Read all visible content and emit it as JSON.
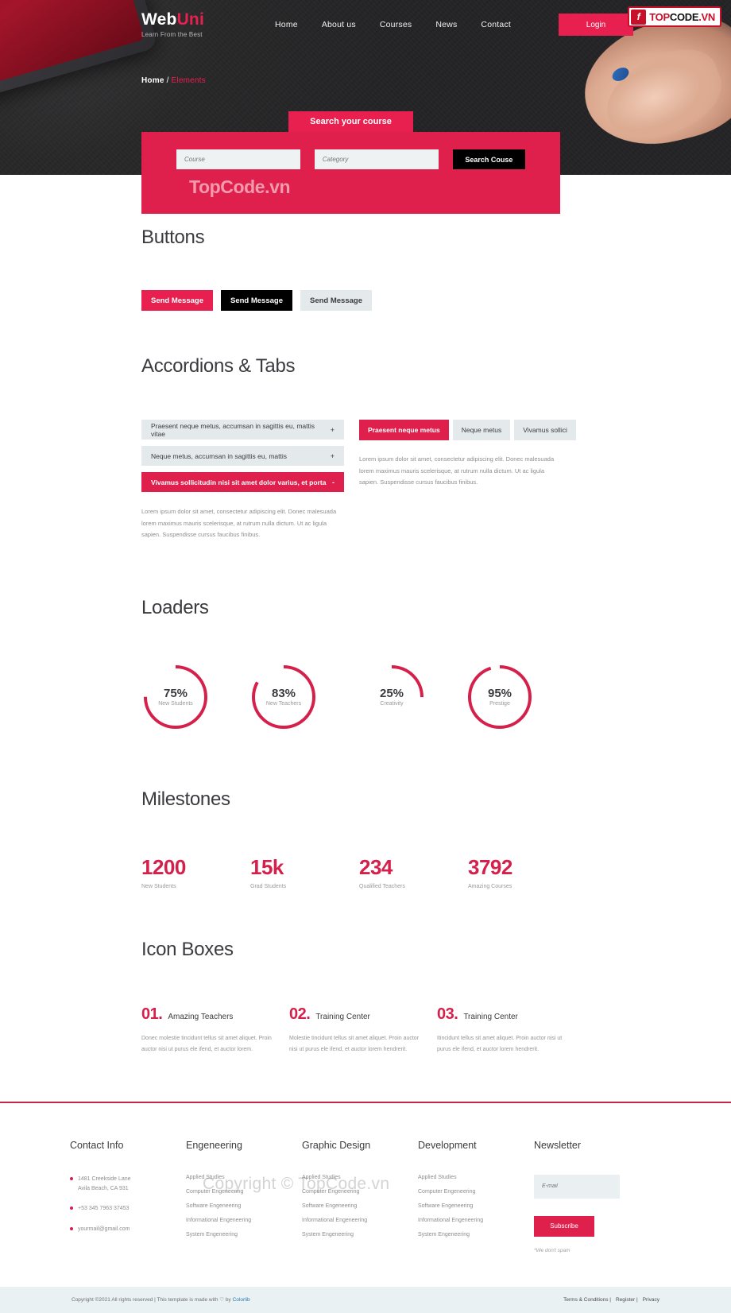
{
  "brand": {
    "accent": "#e0204c",
    "dark": "#232325",
    "light": "#e4eaec"
  },
  "header": {
    "logo_web": "Web",
    "logo_uni": "Uni",
    "tagline": "Learn From the Best",
    "nav": [
      {
        "label": "Home"
      },
      {
        "label": "About us"
      },
      {
        "label": "Courses"
      },
      {
        "label": "News"
      },
      {
        "label": "Contact"
      }
    ],
    "login_label": "Login"
  },
  "badge": {
    "mark": "f",
    "t1": "TOP",
    "t2": "CODE",
    "t3": ".VN"
  },
  "breadcrumb": {
    "home": "Home",
    "sep": "/",
    "current": "Elements"
  },
  "search": {
    "tab_label": "Search your course",
    "course_placeholder": "Course",
    "course_value": "",
    "category_placeholder": "Category",
    "category_value": "",
    "submit_label": "Search Couse",
    "watermark": "TopCode.vn"
  },
  "buttons_section": {
    "title": "Buttons",
    "buttons": [
      {
        "label": "Send Message",
        "style": "primary"
      },
      {
        "label": "Send Message",
        "style": "dark"
      },
      {
        "label": "Send Message",
        "style": "light"
      }
    ]
  },
  "accordions_section": {
    "title": "Accordions & Tabs",
    "accordion": [
      {
        "label": "Praesent neque metus, accumsan in sagittis eu, mattis vitae",
        "sign": "+",
        "active": false
      },
      {
        "label": "Neque metus, accumsan in sagittis eu, mattis",
        "sign": "+",
        "active": false
      },
      {
        "label": "Vivamus sollicitudin nisi sit amet dolor varius, et porta",
        "sign": "-",
        "active": true
      }
    ],
    "accordion_body": "Lorem ipsum dolor sit amet, consectetur adipiscing elit. Donec malesuada lorem maximus mauris scelerisque, at rutrum nulla dictum. Ut ac ligula sapien. Suspendisse cursus faucibus finibus.",
    "tabs": [
      {
        "label": "Praesent neque metus",
        "active": true
      },
      {
        "label": "Neque metus",
        "active": false
      },
      {
        "label": "Vivamus sollici",
        "active": false
      }
    ],
    "tab_body": "Lorem ipsum dolor sit amet, consectetur adipiscing elit. Donec malesuada lorem maximus mauris scelerisque, at rutrum nulla dictum. Ut ac ligula sapien. Suspendisse cursus faucibus finibus."
  },
  "loaders_section": {
    "title": "Loaders",
    "items": [
      {
        "percent": "75%",
        "value": 75,
        "label": "New Students"
      },
      {
        "percent": "83%",
        "value": 83,
        "label": "New Teachers"
      },
      {
        "percent": "25%",
        "value": 25,
        "label": "Creativity"
      },
      {
        "percent": "95%",
        "value": 95,
        "label": "Prestige"
      }
    ]
  },
  "milestones_section": {
    "title": "Milestones",
    "items": [
      {
        "number": "1200",
        "label": "New Students"
      },
      {
        "number": "15k",
        "label": "Grad Students"
      },
      {
        "number": "234",
        "label": "Qualified Teachers"
      },
      {
        "number": "3792",
        "label": "Amazing Courses"
      }
    ]
  },
  "iconboxes_section": {
    "title": "Icon Boxes",
    "items": [
      {
        "number": "01.",
        "title": "Amazing Teachers",
        "text": "Donec molestie tincidunt tellus sit amet aliquet. Proin auctor nisi ut purus ele ifend, et auctor lorem."
      },
      {
        "number": "02.",
        "title": "Training Center",
        "text": "Molestie tincidunt tellus sit amet aliquet. Proin auctor nisi ut purus ele ifend, et auctor lorem hendrerit."
      },
      {
        "number": "03.",
        "title": "Training Center",
        "text": "Itincidunt tellus sit amet aliquet. Proin auctor nisi ut purus ele ifend, et auctor lorem hendrerit."
      }
    ]
  },
  "footer": {
    "watermark": "Copyright © TopCode.vn",
    "contact": {
      "title": "Contact Info",
      "lines": [
        "1481 Creekside Lane\nAvila Beach, CA 931",
        "+53 345 7963 37453",
        "yourmail@gmail.com"
      ]
    },
    "columns": [
      {
        "title": "Engeneering",
        "links": [
          "Applied Studies",
          "Computer Engeneering",
          "Software Engeneering",
          "Informational Engeneering",
          "System Engeneering"
        ]
      },
      {
        "title": "Graphic Design",
        "links": [
          "Applied Studies",
          "Computer Engeneering",
          "Software Engeneering",
          "Informational Engeneering",
          "System Engeneering"
        ]
      },
      {
        "title": "Development",
        "links": [
          "Applied Studies",
          "Computer Engeneering",
          "Software Engeneering",
          "Informational Engeneering",
          "System Engeneering"
        ]
      }
    ],
    "newsletter": {
      "title": "Newsletter",
      "placeholder": "E-mail",
      "value": "",
      "button_label": "Subscribe",
      "note": "*We don't spam"
    },
    "copyright_pre": "Copyright ©2021 All rights reserved | This template is made with ♡ by ",
    "copyright_link": "Colorlib",
    "links": [
      "Terms & Conditions  |",
      "Register  |",
      "Privacy"
    ]
  }
}
